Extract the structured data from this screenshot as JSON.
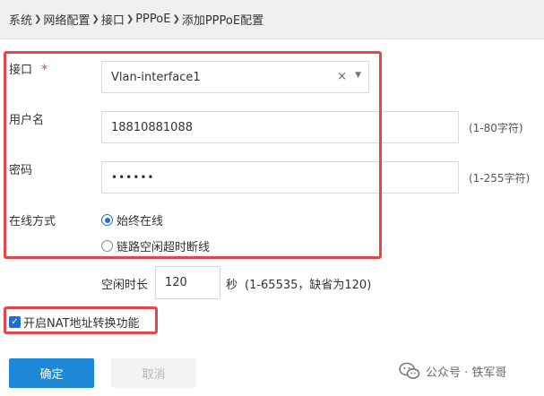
{
  "breadcrumb": [
    "系统",
    "网络配置",
    "接口",
    "PPPoE",
    "添加PPPoE配置"
  ],
  "breadcrumb_separator": "❯",
  "form": {
    "interface": {
      "label": "接口",
      "required_mark": "*",
      "value": "Vlan-interface1",
      "clear_glyph": "×",
      "arrow_glyph": "▼"
    },
    "username": {
      "label": "用户名",
      "value": "18810881088",
      "hint": "(1-80字符)"
    },
    "password": {
      "label": "密码",
      "value": "••••••",
      "hint": "(1-255字符)"
    },
    "online_mode": {
      "label": "在线方式",
      "options": [
        "始终在线",
        "链路空闲超时断线"
      ],
      "selected_index": 0
    },
    "idle": {
      "label": "空闲时长",
      "value": "120",
      "unit": "秒",
      "hint": "(1-65535，缺省为120)"
    },
    "nat": {
      "label": "开启NAT地址转换功能",
      "checked": true,
      "check_glyph": "✓"
    }
  },
  "buttons": {
    "confirm": "确定",
    "cancel": "取消"
  },
  "watermark": "公众号 · 铁军哥",
  "colors": {
    "accent": "#1e88d8",
    "highlight": "#e5454c",
    "required": "#e0393e",
    "radio": "#1e6fd6"
  }
}
